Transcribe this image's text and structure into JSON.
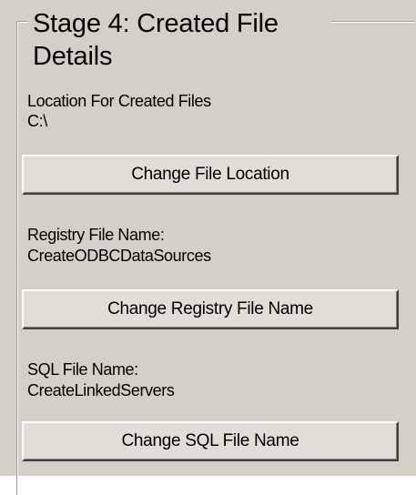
{
  "group": {
    "title_line1": "Stage 4: Created File",
    "title_line2": "Details"
  },
  "location": {
    "label": "Location For Created Files",
    "value": "C:\\",
    "button_label": "Change File Location"
  },
  "registry": {
    "label": "Registry File Name:",
    "value": "CreateODBCDataSources",
    "button_label": "Change Registry File Name"
  },
  "sql": {
    "label": "SQL File Name:",
    "value": "CreateLinkedServers",
    "button_label": "Change SQL File Name"
  }
}
